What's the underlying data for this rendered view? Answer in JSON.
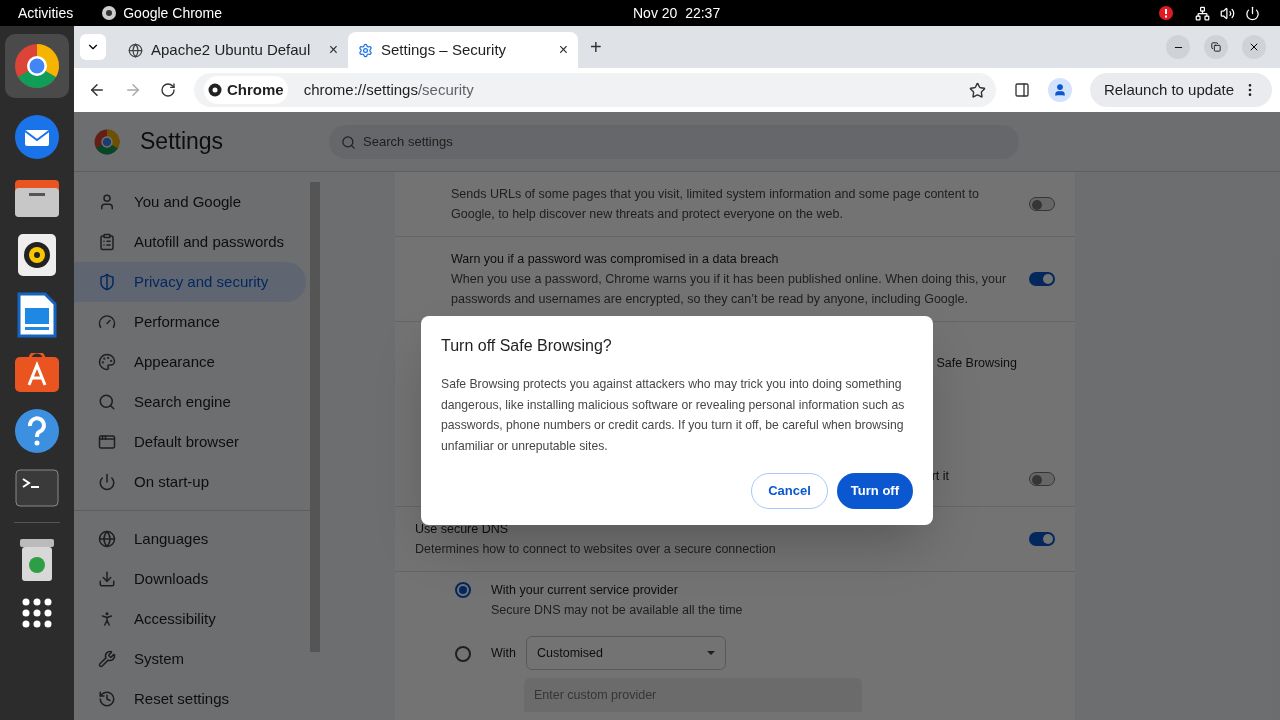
{
  "top_bar": {
    "activities": "Activities",
    "app_name": "Google Chrome",
    "clock": "Nov 20  22:37"
  },
  "browser": {
    "tabs": [
      {
        "title": "Apache2 Ubuntu Defaul",
        "selected": false,
        "close": "×"
      },
      {
        "title": "Settings – Security",
        "selected": true,
        "close": "×"
      }
    ],
    "new_tab": "+",
    "chip": "Chrome",
    "url_host": "chrome://settings",
    "url_path": "/security",
    "relaunch": "Relaunch to update"
  },
  "settings": {
    "title": "Settings",
    "search_placeholder": "Search settings",
    "sidebar": [
      [
        {
          "label": "You and Google",
          "selected": false
        },
        {
          "label": "Autofill and passwords",
          "selected": false
        },
        {
          "label": "Privacy and security",
          "selected": true
        },
        {
          "label": "Performance",
          "selected": false
        },
        {
          "label": "Appearance",
          "selected": false
        },
        {
          "label": "Search engine",
          "selected": false
        },
        {
          "label": "Default browser",
          "selected": false
        },
        {
          "label": "On start-up",
          "selected": false
        }
      ],
      [
        {
          "label": "Languages",
          "selected": false
        },
        {
          "label": "Downloads",
          "selected": false
        },
        {
          "label": "Accessibility",
          "selected": false
        },
        {
          "label": "System",
          "selected": false
        },
        {
          "label": "Reset settings",
          "selected": false
        }
      ]
    ],
    "rows": [
      {
        "kind": "toggle",
        "description": "Sends URLs of some pages that you visit, limited system information and some page content to Google, to help discover new threats and protect everyone on the web.",
        "on": false
      },
      {
        "kind": "toggle",
        "title": "Warn you if a password was compromised in a data breach",
        "description": "When you use a password, Chrome warns you if it has been published online. When doing this, your passwords and usernames are encrypted, so they can’t be read by anyone, including Google.",
        "on": true
      },
      {
        "kind": "fragment",
        "text": "Safe Browsing"
      },
      {
        "kind": "fragment",
        "text": "rt it",
        "on": false
      },
      {
        "kind": "toggle",
        "title": "Use secure DNS",
        "description": "Determines how to connect to websites over a secure connection",
        "on": true
      },
      {
        "kind": "radio",
        "title": "With your current service provider",
        "description": "Secure DNS may not be available all the time",
        "selected": true
      },
      {
        "kind": "radio_select",
        "title": "With",
        "value": "Customised",
        "placeholder": "Enter custom provider",
        "selected": false
      }
    ]
  },
  "dialog": {
    "title": "Turn off Safe Browsing?",
    "body": "Safe Browsing protects you against attackers who may trick you into doing something dangerous, like installing malicious software or revealing personal information such as passwords, phone numbers or credit cards. If you turn it off, be careful when browsing unfamiliar or unreputable sites.",
    "buttons": [
      {
        "label": "Cancel",
        "kind": "secondary"
      },
      {
        "label": "Turn off",
        "kind": "primary"
      }
    ]
  }
}
